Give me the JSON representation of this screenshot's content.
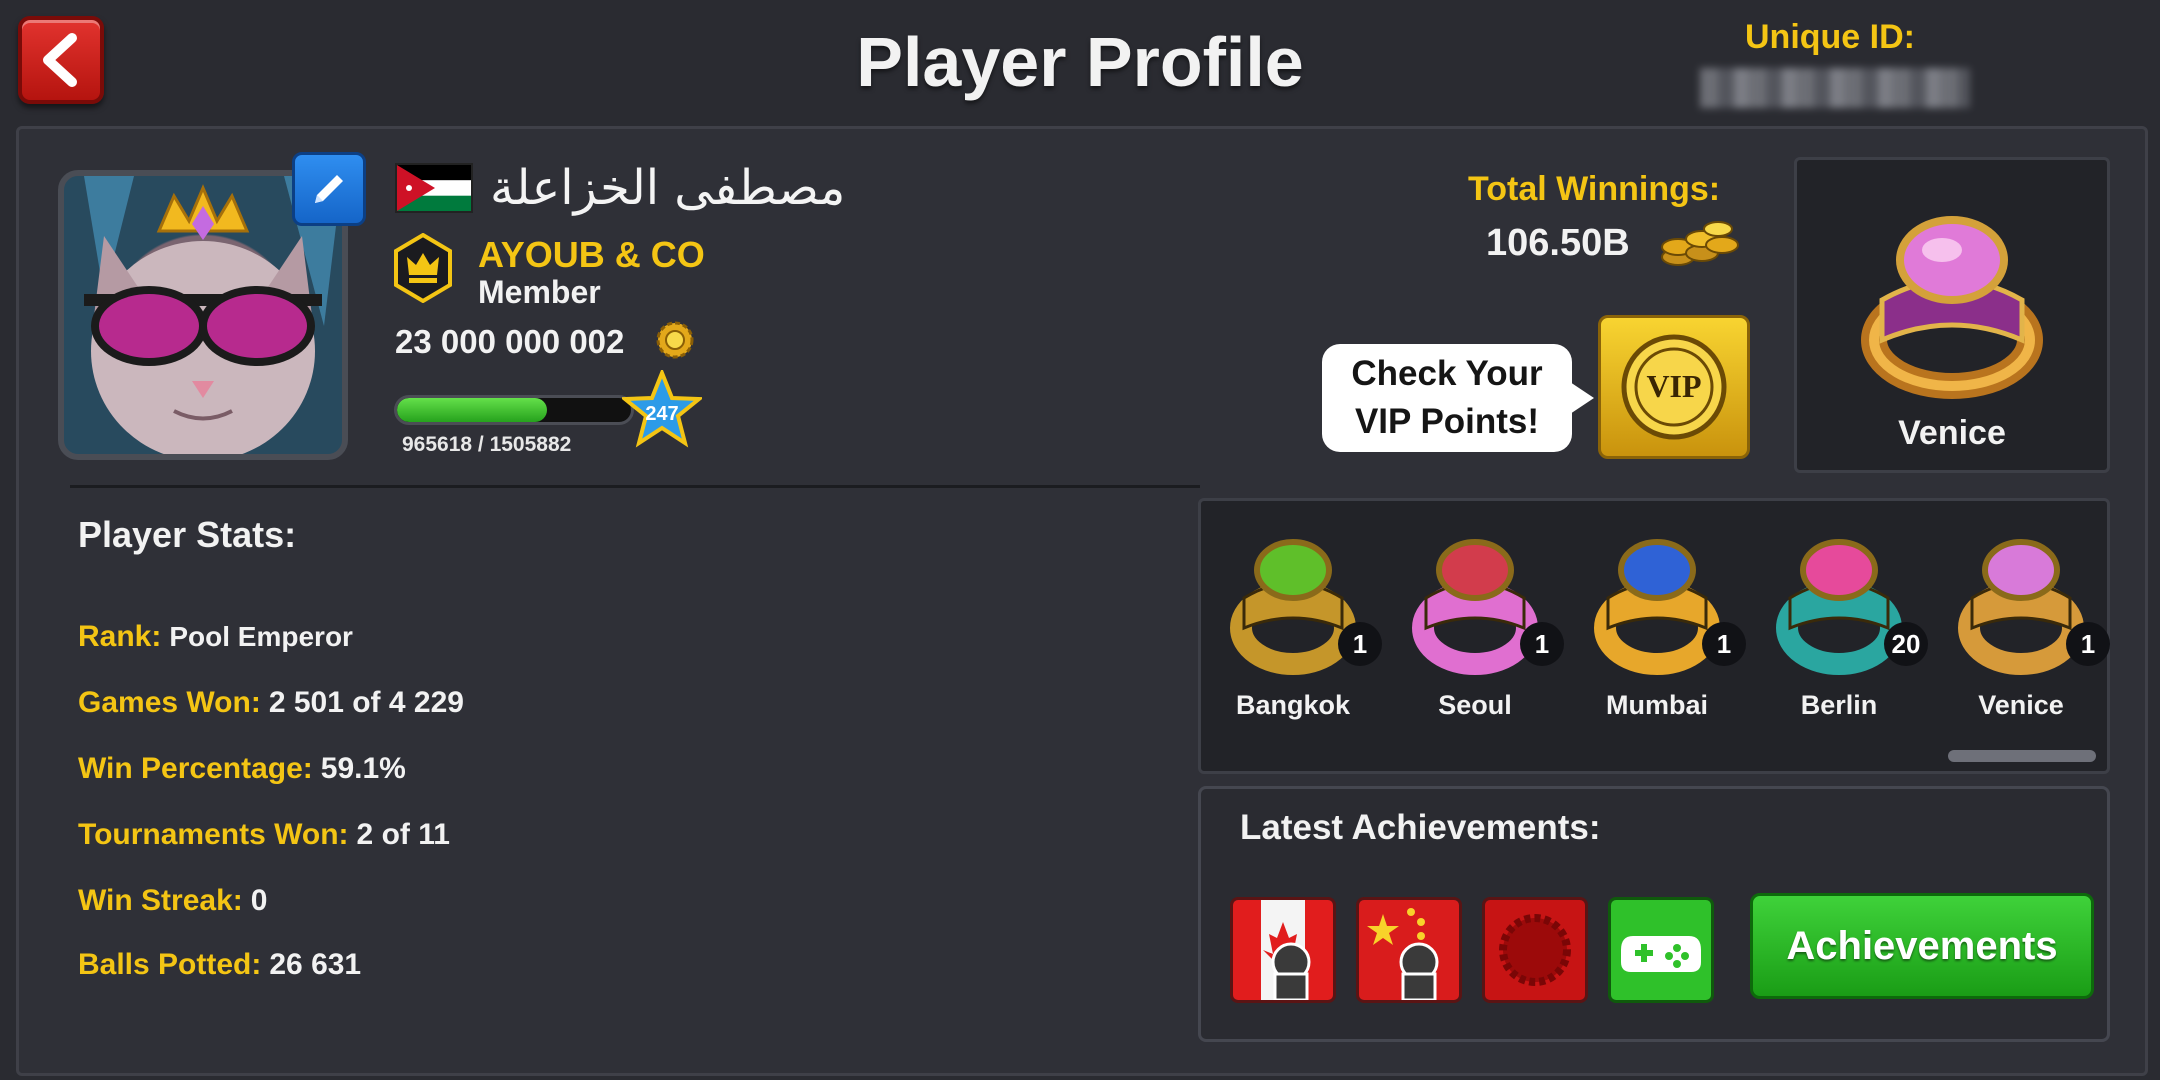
{
  "header": {
    "title": "Player Profile",
    "unique_id_label": "Unique ID:"
  },
  "profile": {
    "name": "مصطفى الخزاعلة",
    "club_name": "AYOUB & CO",
    "club_role": "Member",
    "coins": "23 000 000 002",
    "level": "247",
    "xp_text": "965618 / 1505882",
    "xp_fraction": 0.641
  },
  "winnings": {
    "label": "Total Winnings:",
    "value": "106.50B"
  },
  "vip": {
    "bubble_line1": "Check Your",
    "bubble_line2": "VIP Points!",
    "badge_text": "VIP"
  },
  "equipped": {
    "name": "Venice"
  },
  "stats": {
    "title": "Player Stats:",
    "rows": [
      {
        "label": "Rank:",
        "value": "Pool Emperor"
      },
      {
        "label": "Games Won:",
        "value": "2 501 of 4 229"
      },
      {
        "label": "Win Percentage:",
        "value": "59.1%"
      },
      {
        "label": "Tournaments Won:",
        "value": "2 of 11"
      },
      {
        "label": "Win Streak:",
        "value": "0"
      },
      {
        "label": "Balls Potted:",
        "value": "26 631"
      }
    ]
  },
  "rings": [
    {
      "name": "Bangkok",
      "count": "1",
      "color": "#c5962a",
      "gem": "#5fbf2a"
    },
    {
      "name": "Seoul",
      "count": "1",
      "color": "#e06fd0",
      "gem": "#d23c4c"
    },
    {
      "name": "Mumbai",
      "count": "1",
      "color": "#e7a72b",
      "gem": "#2f62d6"
    },
    {
      "name": "Berlin",
      "count": "20",
      "color": "#2aa6a0",
      "gem": "#e64a9b"
    },
    {
      "name": "Venice",
      "count": "1",
      "color": "#d69a3a",
      "gem": "#d87ad9"
    }
  ],
  "achievements": {
    "title": "Latest Achievements:",
    "button_label": "Achievements",
    "badges": [
      "canada-flag-badge",
      "china-flag-badge",
      "red-seal-badge",
      "google-play-games-badge"
    ]
  }
}
